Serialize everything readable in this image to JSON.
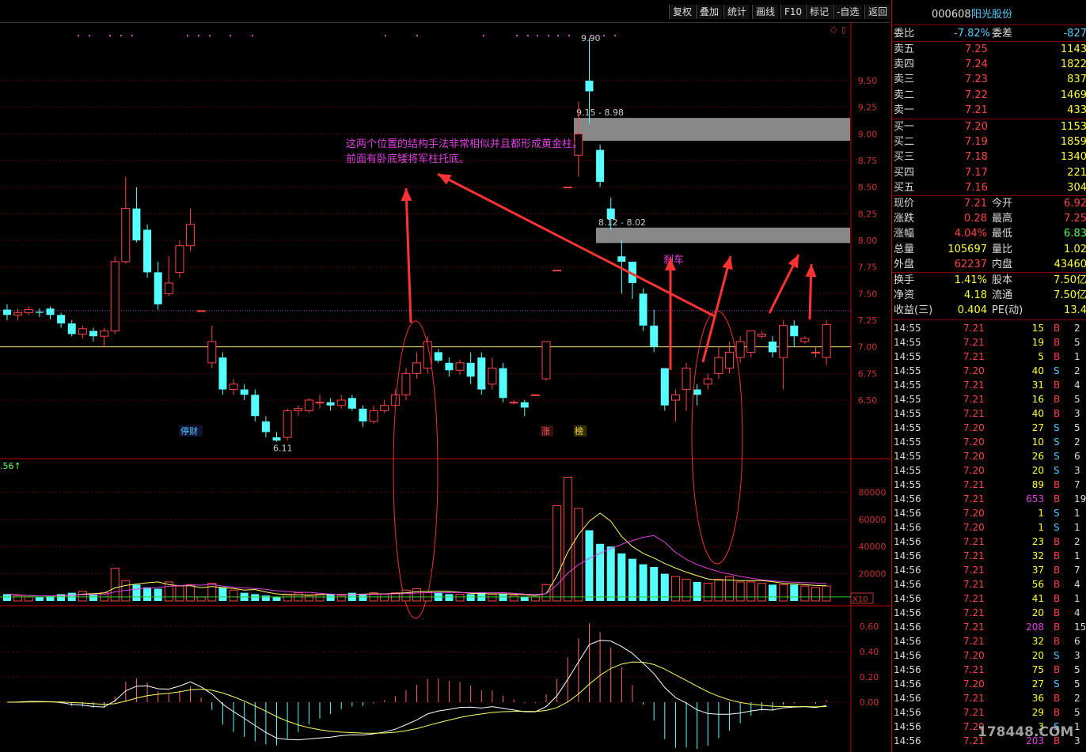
{
  "toolbar": [
    "复权",
    "叠加",
    "统计",
    "画线",
    "F10",
    "标记",
    "-自选",
    "返回"
  ],
  "stock": {
    "code": "000608",
    "name": "阳光股份"
  },
  "quote": {
    "weibi": {
      "label": "委比",
      "value": "-7.82%",
      "label2": "委差",
      "value2": "-827"
    },
    "asks": [
      {
        "label": "卖五",
        "price": "7.25",
        "vol": "1143"
      },
      {
        "label": "卖四",
        "price": "7.24",
        "vol": "1822"
      },
      {
        "label": "卖三",
        "price": "7.23",
        "vol": "837"
      },
      {
        "label": "卖二",
        "price": "7.22",
        "vol": "1469"
      },
      {
        "label": "卖一",
        "price": "7.21",
        "vol": "433"
      }
    ],
    "bids": [
      {
        "label": "买一",
        "price": "7.20",
        "vol": "1153"
      },
      {
        "label": "买二",
        "price": "7.19",
        "vol": "1859"
      },
      {
        "label": "买三",
        "price": "7.18",
        "vol": "1340"
      },
      {
        "label": "买四",
        "price": "7.17",
        "vol": "221"
      },
      {
        "label": "买五",
        "price": "7.16",
        "vol": "304"
      }
    ],
    "stats": [
      {
        "l1": "现价",
        "v1": "7.21",
        "l2": "今开",
        "v2": "6.92"
      },
      {
        "l1": "涨跌",
        "v1": "0.28",
        "l2": "最高",
        "v2": "7.25"
      },
      {
        "l1": "涨幅",
        "v1": "4.04%",
        "l2": "最低",
        "v2": "6.83"
      },
      {
        "l1": "总量",
        "v1": "105697",
        "l2": "量比",
        "v2": "1.02"
      },
      {
        "l1": "外盘",
        "v1": "62237",
        "l2": "内盘",
        "v2": "43460"
      }
    ],
    "stats2": [
      {
        "l1": "换手",
        "v1": "1.41%",
        "l2": "股本",
        "v2": "7.50亿"
      },
      {
        "l1": "净资",
        "v1": "4.18",
        "l2": "流通",
        "v2": "7.50亿"
      },
      {
        "l1": "收益(三)",
        "v1": "0.404",
        "l2": "PE(动)",
        "v2": "13.4"
      }
    ]
  },
  "ticks": [
    [
      "14:55",
      "7.21",
      "15",
      "B",
      "2"
    ],
    [
      "14:55",
      "7.21",
      "19",
      "B",
      "5"
    ],
    [
      "14:55",
      "7.21",
      "5",
      "B",
      "1"
    ],
    [
      "14:55",
      "7.20",
      "40",
      "S",
      "2"
    ],
    [
      "14:55",
      "7.21",
      "31",
      "B",
      "4"
    ],
    [
      "14:55",
      "7.21",
      "16",
      "B",
      "5"
    ],
    [
      "14:55",
      "7.21",
      "40",
      "B",
      "3"
    ],
    [
      "14:55",
      "7.20",
      "27",
      "S",
      "5"
    ],
    [
      "14:55",
      "7.20",
      "10",
      "S",
      "2"
    ],
    [
      "14:55",
      "7.20",
      "26",
      "S",
      "6"
    ],
    [
      "14:55",
      "7.20",
      "20",
      "S",
      "3"
    ],
    [
      "14:55",
      "7.21",
      "89",
      "B",
      "7"
    ],
    [
      "14:56",
      "7.21",
      "653",
      "B",
      "19"
    ],
    [
      "14:56",
      "7.20",
      "1",
      "S",
      "1"
    ],
    [
      "14:56",
      "7.20",
      "1",
      "S",
      "1"
    ],
    [
      "14:56",
      "7.21",
      "23",
      "B",
      "2"
    ],
    [
      "14:56",
      "7.21",
      "32",
      "B",
      "1"
    ],
    [
      "14:56",
      "7.21",
      "37",
      "B",
      "7"
    ],
    [
      "14:56",
      "7.21",
      "56",
      "B",
      "4"
    ],
    [
      "14:56",
      "7.21",
      "41",
      "B",
      "1"
    ],
    [
      "14:56",
      "7.21",
      "20",
      "B",
      "4"
    ],
    [
      "14:56",
      "7.21",
      "208",
      "B",
      "15"
    ],
    [
      "14:56",
      "7.21",
      "32",
      "B",
      "6"
    ],
    [
      "14:56",
      "7.20",
      "20",
      "S",
      "3"
    ],
    [
      "14:56",
      "7.21",
      "75",
      "B",
      "5"
    ],
    [
      "14:56",
      "7.20",
      "27",
      "S",
      "5"
    ],
    [
      "14:56",
      "7.21",
      "36",
      "B",
      "2"
    ],
    [
      "14:56",
      "7.21",
      "29",
      "B",
      "5"
    ],
    [
      "14:56",
      "7.20",
      "3",
      "S",
      "1"
    ],
    [
      "14:56",
      "7.21",
      "203",
      "B",
      "3"
    ]
  ],
  "annotations": {
    "text1": "这两个位置的结构手法非常相似并且都形成黄金柱。",
    "text2": "前面有卧底矮将军柱托底。",
    "brake": "刹车",
    "zone1": "9.15 - 8.98",
    "zone2": "8.12 - 8.02",
    "high": "9.90",
    "low": "6.11",
    "marker_cai": "停财",
    "marker_zhang": "涨",
    "marker_bang": "榜",
    "vol_label": ".56↑",
    "x10": "X10",
    "watermark": "178448.COM"
  },
  "chart_data": {
    "type": "candlestick",
    "price_axis": {
      "ticks": [
        "9.50",
        "9.25",
        "9.00",
        "8.75",
        "8.50",
        "8.25",
        "8.00",
        "7.75",
        "7.50",
        "7.25",
        "7.00",
        "6.75",
        "6.50"
      ],
      "range": [
        6.0,
        10.0
      ]
    },
    "volume_axis": {
      "ticks": [
        "80000",
        "60000",
        "40000",
        "20000"
      ],
      "range": [
        0,
        100000
      ]
    },
    "macd_axis": {
      "ticks": [
        "0.60",
        "0.40",
        "0.20",
        "0.00"
      ],
      "range": [
        -0.35,
        0.75
      ]
    },
    "candles": [
      [
        7.35,
        7.3,
        7.4,
        7.25
      ],
      [
        7.3,
        7.32,
        7.36,
        7.25
      ],
      [
        7.32,
        7.35,
        7.38,
        7.3
      ],
      [
        7.33,
        7.32,
        7.36,
        7.28
      ],
      [
        7.36,
        7.3,
        7.38,
        7.26
      ],
      [
        7.3,
        7.22,
        7.32,
        7.18
      ],
      [
        7.22,
        7.12,
        7.25,
        7.1
      ],
      [
        7.12,
        7.17,
        7.2,
        7.08
      ],
      [
        7.15,
        7.1,
        7.18,
        7.05
      ],
      [
        7.1,
        7.15,
        7.18,
        7.0
      ],
      [
        7.15,
        7.8,
        7.85,
        7.12
      ],
      [
        7.8,
        8.3,
        8.6,
        7.78
      ],
      [
        8.3,
        8.0,
        8.5,
        7.98
      ],
      [
        8.1,
        7.7,
        8.15,
        7.65
      ],
      [
        7.7,
        7.4,
        7.8,
        7.35
      ],
      [
        7.5,
        7.6,
        7.85,
        7.48
      ],
      [
        7.7,
        7.95,
        8.0,
        7.65
      ],
      [
        7.95,
        8.15,
        8.3,
        7.9
      ],
      [
        7.34,
        7.34,
        7.34,
        7.34
      ],
      [
        6.85,
        7.05,
        7.2,
        6.8
      ],
      [
        6.9,
        6.6,
        6.95,
        6.55
      ],
      [
        6.6,
        6.65,
        6.7,
        6.55
      ],
      [
        6.6,
        6.55,
        6.65,
        6.5
      ],
      [
        6.55,
        6.35,
        6.6,
        6.3
      ],
      [
        6.3,
        6.2,
        6.35,
        6.15
      ],
      [
        6.15,
        6.12,
        6.2,
        6.11
      ],
      [
        6.15,
        6.4,
        6.42,
        6.12
      ],
      [
        6.4,
        6.42,
        6.45,
        6.35
      ],
      [
        6.4,
        6.5,
        6.52,
        6.38
      ],
      [
        6.48,
        6.48,
        6.55,
        6.42
      ],
      [
        6.48,
        6.45,
        6.52,
        6.4
      ],
      [
        6.45,
        6.5,
        6.55,
        6.42
      ],
      [
        6.52,
        6.42,
        6.55,
        6.4
      ],
      [
        6.42,
        6.3,
        6.45,
        6.25
      ],
      [
        6.3,
        6.4,
        6.45,
        6.28
      ],
      [
        6.4,
        6.45,
        6.5,
        6.38
      ],
      [
        6.45,
        6.55,
        6.6,
        6.42
      ],
      [
        6.55,
        6.75,
        6.8,
        6.5
      ],
      [
        6.75,
        6.85,
        6.95,
        6.7
      ],
      [
        6.8,
        7.05,
        7.1,
        6.75
      ],
      [
        6.95,
        6.87,
        6.98,
        6.85
      ],
      [
        6.85,
        6.78,
        6.9,
        6.72
      ],
      [
        6.78,
        6.85,
        6.88,
        6.74
      ],
      [
        6.85,
        6.72,
        6.95,
        6.65
      ],
      [
        6.9,
        6.6,
        6.95,
        6.55
      ],
      [
        6.65,
        6.8,
        6.9,
        6.6
      ],
      [
        6.8,
        6.52,
        6.85,
        6.48
      ],
      [
        6.48,
        6.48,
        6.5,
        6.46
      ],
      [
        6.48,
        6.43,
        6.5,
        6.35
      ],
      [
        6.55,
        6.55,
        6.55,
        6.55
      ],
      [
        6.7,
        7.05,
        7.05,
        6.68
      ],
      [
        7.72,
        7.72,
        7.72,
        7.72
      ],
      [
        8.5,
        8.5,
        8.5,
        8.5
      ],
      [
        8.8,
        9.0,
        9.3,
        8.6
      ],
      [
        9.5,
        9.4,
        9.9,
        9.1
      ],
      [
        8.85,
        8.55,
        8.9,
        8.5
      ],
      [
        8.3,
        8.2,
        8.4,
        8.1
      ],
      [
        7.85,
        7.8,
        8.0,
        7.5
      ],
      [
        7.8,
        7.6,
        7.8,
        7.45
      ],
      [
        7.5,
        7.2,
        7.55,
        7.15
      ],
      [
        7.2,
        7.0,
        7.35,
        6.95
      ],
      [
        6.8,
        6.45,
        6.8,
        6.4
      ],
      [
        6.5,
        6.55,
        6.6,
        6.3
      ],
      [
        6.6,
        6.8,
        6.85,
        6.4
      ],
      [
        6.6,
        6.55,
        6.65,
        6.45
      ],
      [
        6.65,
        6.7,
        6.75,
        6.6
      ],
      [
        6.75,
        6.9,
        7.0,
        6.7
      ],
      [
        6.8,
        6.95,
        7.05,
        6.75
      ],
      [
        6.9,
        7.05,
        7.1,
        6.85
      ],
      [
        6.95,
        7.15,
        7.15,
        6.9
      ],
      [
        7.1,
        7.12,
        7.15,
        7.08
      ],
      [
        7.05,
        6.95,
        7.1,
        6.9
      ],
      [
        6.9,
        7.2,
        7.25,
        6.6
      ],
      [
        7.2,
        7.1,
        7.25,
        7.0
      ],
      [
        7.05,
        7.08,
        7.1,
        7.03
      ],
      [
        6.95,
        6.95,
        7.0,
        6.9
      ],
      [
        6.9,
        7.21,
        7.25,
        6.83
      ]
    ],
    "volumes": [
      5,
      4,
      3,
      3,
      4,
      5,
      6,
      7,
      5,
      6,
      24,
      15,
      12,
      10,
      9,
      14,
      11,
      12,
      3,
      13,
      10,
      8,
      6,
      5,
      4,
      3,
      5,
      6,
      4,
      5,
      5,
      4,
      6,
      5,
      6,
      5,
      6,
      8,
      9,
      7,
      6,
      5,
      5,
      5,
      6,
      5,
      5,
      4,
      3,
      3,
      12,
      70,
      91,
      68,
      52,
      42,
      40,
      35,
      31,
      27,
      25,
      20,
      18,
      16,
      14,
      13,
      16,
      18,
      14,
      14,
      13,
      12,
      12,
      12,
      11,
      10,
      11
    ]
  }
}
